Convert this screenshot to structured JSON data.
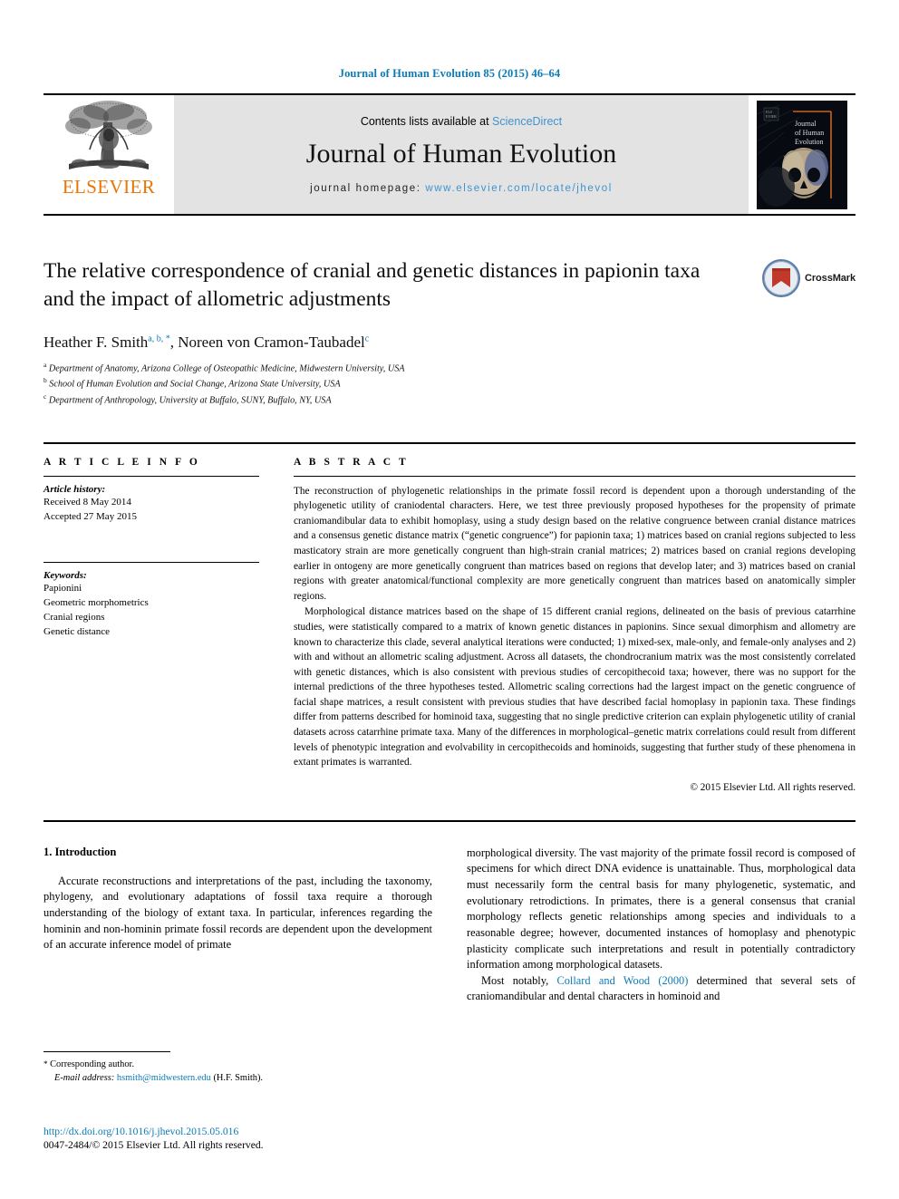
{
  "running_head": "Journal of Human Evolution 85 (2015) 46–64",
  "masthead": {
    "publisher": "ELSEVIER",
    "contents_prefix": "Contents lists available at ",
    "contents_link": "ScienceDirect",
    "journal_title": "Journal of Human Evolution",
    "homepage_prefix": "journal homepage: ",
    "homepage_url": "www.elsevier.com/locate/jhevol",
    "cover_title_line1": "Journal",
    "cover_title_line2": "of Human",
    "cover_title_line3": "Evolution"
  },
  "article": {
    "title": "The relative correspondence of cranial and genetic distances in papionin taxa and the impact of allometric adjustments",
    "authors": "Heather F. Smith a, b, *, Noreen von Cramon-Taubadel c",
    "author1_name": "Heather F. Smith",
    "author1_sups": "a, b, *",
    "author2_name": ", Noreen von Cramon-Taubadel",
    "author2_sups": "c",
    "affiliations": [
      {
        "marker": "a",
        "text": "Department of Anatomy, Arizona College of Osteopathic Medicine, Midwestern University, USA"
      },
      {
        "marker": "b",
        "text": "School of Human Evolution and Social Change, Arizona State University, USA"
      },
      {
        "marker": "c",
        "text": "Department of Anthropology, University at Buffalo, SUNY, Buffalo, NY, USA"
      }
    ],
    "crossmark_label": "CrossMark"
  },
  "article_info": {
    "heading": "A R T I C L E  I N F O",
    "history_label": "Article history:",
    "received": "Received 8 May 2014",
    "accepted": "Accepted 27 May 2015",
    "keywords_label": "Keywords:",
    "keywords": [
      "Papionini",
      "Geometric morphometrics",
      "Cranial regions",
      "Genetic distance"
    ]
  },
  "abstract": {
    "heading": "A B S T R A C T",
    "paragraph1": "The reconstruction of phylogenetic relationships in the primate fossil record is dependent upon a thorough understanding of the phylogenetic utility of craniodental characters. Here, we test three previously proposed hypotheses for the propensity of primate craniomandibular data to exhibit homoplasy, using a study design based on the relative congruence between cranial distance matrices and a consensus genetic distance matrix (“genetic congruence”) for papionin taxa; 1) matrices based on cranial regions subjected to less masticatory strain are more genetically congruent than high-strain cranial matrices; 2) matrices based on cranial regions developing earlier in ontogeny are more genetically congruent than matrices based on regions that develop later; and 3) matrices based on cranial regions with greater anatomical/functional complexity are more genetically congruent than matrices based on anatomically simpler regions.",
    "paragraph2": "Morphological distance matrices based on the shape of 15 different cranial regions, delineated on the basis of previous catarrhine studies, were statistically compared to a matrix of known genetic distances in papionins. Since sexual dimorphism and allometry are known to characterize this clade, several analytical iterations were conducted; 1) mixed-sex, male-only, and female-only analyses and 2) with and without an allometric scaling adjustment. Across all datasets, the chondrocranium matrix was the most consistently correlated with genetic distances, which is also consistent with previous studies of cercopithecoid taxa; however, there was no support for the internal predictions of the three hypotheses tested. Allometric scaling corrections had the largest impact on the genetic congruence of facial shape matrices, a result consistent with previous studies that have described facial homoplasy in papionin taxa. These findings differ from patterns described for hominoid taxa, suggesting that no single predictive criterion can explain phylogenetic utility of cranial datasets across catarrhine primate taxa. Many of the differences in morphological–genetic matrix correlations could result from different levels of phenotypic integration and evolvability in cercopithecoids and hominoids, suggesting that further study of these phenomena in extant primates is warranted.",
    "copyright": "© 2015 Elsevier Ltd. All rights reserved."
  },
  "body": {
    "section_heading": "1. Introduction",
    "left_paragraph": "Accurate reconstructions and interpretations of the past, including the taxonomy, phylogeny, and evolutionary adaptations of fossil taxa require a thorough understanding of the biology of extant taxa. In particular, inferences regarding the hominin and non-hominin primate fossil records are dependent upon the development of an accurate inference model of primate",
    "right_paragraph_continued": "morphological diversity. The vast majority of the primate fossil record is composed of specimens for which direct DNA evidence is unattainable. Thus, morphological data must necessarily form the central basis for many phylogenetic, systematic, and evolutionary retrodictions. In primates, there is a general consensus that cranial morphology reflects genetic relationships among species and individuals to a reasonable degree; however, documented instances of homoplasy and phenotypic plasticity complicate such interpretations and result in potentially contradictory information among morphological datasets.",
    "right_paragraph2_pre": "Most notably, ",
    "right_paragraph2_cite": "Collard and Wood (2000)",
    "right_paragraph2_post": " determined that several sets of craniomandibular and dental characters in hominoid and"
  },
  "footnotes": {
    "corresponding_marker": "*",
    "corresponding_text": "Corresponding author.",
    "email_label": "E-mail address:",
    "email": "hsmith@midwestern.edu",
    "email_owner": "(H.F. Smith).",
    "doi": "http://dx.doi.org/10.1016/j.jhevol.2015.05.016",
    "issn_copyright": "0047-2484/© 2015 Elsevier Ltd. All rights reserved."
  },
  "colors": {
    "link_blue": "#0b7bb5",
    "elsevier_orange": "#ec7404",
    "banner_gray": "#e3e3e3",
    "crossmark_red": "#c0392b"
  }
}
